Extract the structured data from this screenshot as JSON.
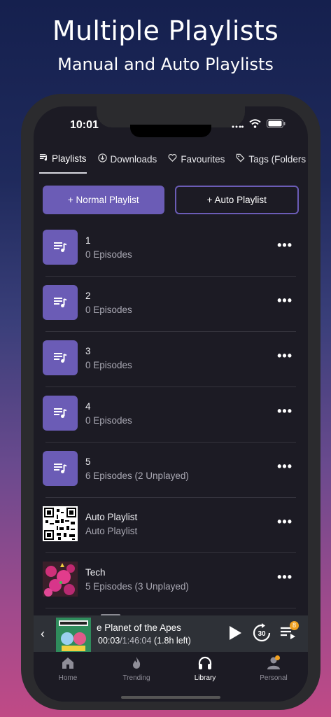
{
  "promo": {
    "title": "Multiple Playlists",
    "subtitle": "Manual and Auto Playlists"
  },
  "status_bar": {
    "time": "10:01"
  },
  "tabs": [
    {
      "label": "Playlists",
      "icon": "playlist-icon",
      "active": true
    },
    {
      "label": "Downloads",
      "icon": "download-icon",
      "active": false
    },
    {
      "label": "Favourites",
      "icon": "heart-icon",
      "active": false
    },
    {
      "label": "Tags (Folders",
      "icon": "tag-icon",
      "active": false
    }
  ],
  "buttons": {
    "normal_playlist": "+ Normal Playlist",
    "auto_playlist": "+ Auto Playlist"
  },
  "playlists": [
    {
      "title": "1",
      "subtitle": "0 Episodes",
      "thumb": "playlist-icon"
    },
    {
      "title": "2",
      "subtitle": "0 Episodes",
      "thumb": "playlist-icon"
    },
    {
      "title": "3",
      "subtitle": "0 Episodes",
      "thumb": "playlist-icon"
    },
    {
      "title": "4",
      "subtitle": "0 Episodes",
      "thumb": "playlist-icon"
    },
    {
      "title": "5",
      "subtitle": "6 Episodes (2 Unplayed)",
      "thumb": "playlist-icon"
    },
    {
      "title": "Auto Playlist",
      "subtitle": "Auto Playlist",
      "thumb": "qr-code-art"
    },
    {
      "title": "Tech",
      "subtitle": "5 Episodes (3 Unplayed)",
      "thumb": "podcast-art"
    }
  ],
  "more_glyph": "•••",
  "player": {
    "title": "e Planet of the Apes",
    "elapsed": "00:03",
    "duration": "/1:46:04",
    "remaining": "(1.8h left)",
    "skip_seconds": "30",
    "queue_count": "8",
    "chevron": "‹"
  },
  "tabbar": [
    {
      "label": "Home",
      "icon": "home-icon",
      "active": false
    },
    {
      "label": "Trending",
      "icon": "flame-icon",
      "active": false
    },
    {
      "label": "Library",
      "icon": "headphones-icon",
      "active": true
    },
    {
      "label": "Personal",
      "icon": "person-icon",
      "active": false
    }
  ],
  "colors": {
    "accent": "#6b5cb6",
    "background": "#1c1b24",
    "badge": "#f0a020"
  }
}
